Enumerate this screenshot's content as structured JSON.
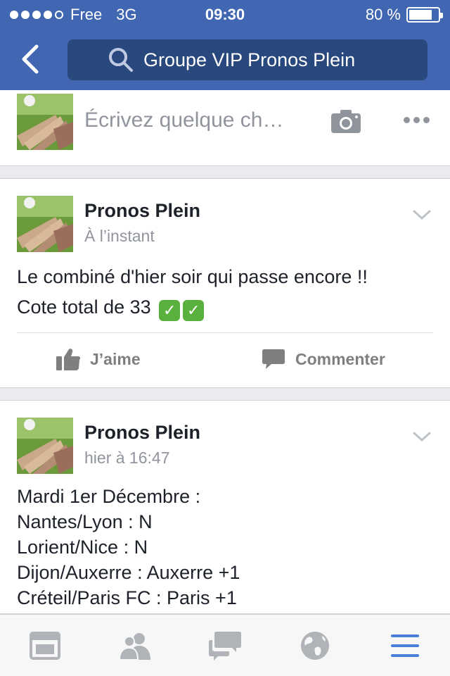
{
  "status_bar": {
    "carrier": "Free",
    "network": "3G",
    "time": "09:30",
    "battery": "80 %",
    "battery_level": 0.8
  },
  "header": {
    "search_text": "Groupe VIP Pronos Plein"
  },
  "composer": {
    "placeholder": "Écrivez quelque ch…"
  },
  "posts": [
    {
      "author": "Pronos Plein",
      "time": "À l’instant",
      "lines": [
        "Le combiné d'hier soir qui passe encore !!",
        "Cote total de 33"
      ],
      "emoji": [
        "✓",
        "✓"
      ],
      "like_label": "J’aime",
      "comment_label": "Commenter"
    },
    {
      "author": "Pronos Plein",
      "time": "hier à 16:47",
      "lines": [
        "Mardi 1er Décembre :",
        "Nantes/Lyon : N",
        "Lorient/Nice : N",
        "Dijon/Auxerre : Auxerre +1",
        "Créteil/Paris FC : Paris +1"
      ]
    }
  ],
  "colors": {
    "header": "#4267b2",
    "search": "#29487d",
    "active_tab": "#4a80d8",
    "muted": "#90949c"
  },
  "tabs": [
    "news-feed-icon",
    "friends-icon",
    "messages-icon",
    "notifications-globe-icon",
    "menu-icon"
  ]
}
